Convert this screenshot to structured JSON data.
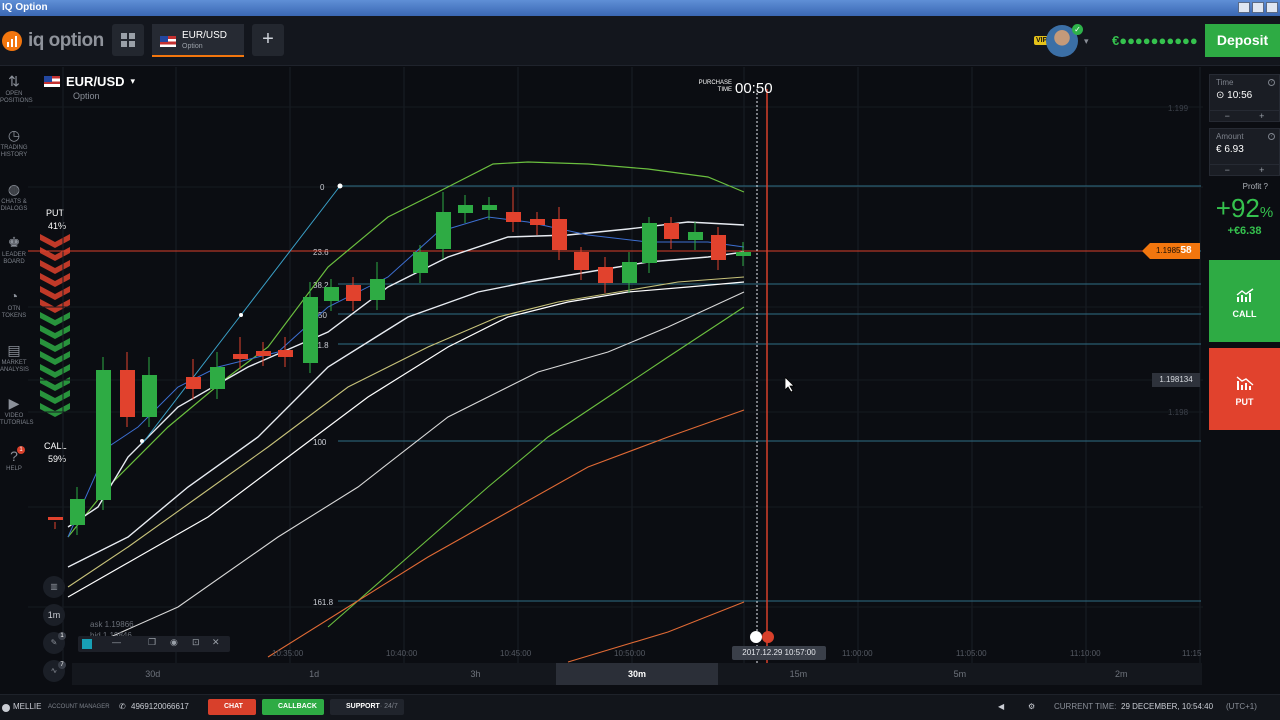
{
  "window": {
    "title": "IQ Option"
  },
  "header": {
    "logo_text": "iq option",
    "asset_tab": {
      "name": "EUR/USD",
      "type": "Option"
    },
    "add_label": "+",
    "vip_label": "VIP",
    "balance": "€●●●●●●●●●●",
    "deposit_label": "Deposit"
  },
  "leftnav": [
    {
      "icon": "arrows-updown-icon",
      "label": "OPEN POSITIONS"
    },
    {
      "icon": "history-icon",
      "label": "TRADING HISTORY"
    },
    {
      "icon": "chat-icon",
      "label": "CHATS & DIALOGS"
    },
    {
      "icon": "leaderboard-icon",
      "label": "LEADER BOARD"
    },
    {
      "icon": "token-icon",
      "label": "OTN TOKENS"
    },
    {
      "icon": "analysis-icon",
      "label": "MARKET ANALYSIS"
    },
    {
      "icon": "play-icon",
      "label": "VIDEO TUTORIALS"
    },
    {
      "icon": "help-icon",
      "label": "HELP",
      "badge": "1"
    }
  ],
  "chart": {
    "asset_name": "EUR/USD",
    "asset_type": "Option",
    "purchase_label": "PURCHASE TIME",
    "purchase_timer": "00:50",
    "sentiment": {
      "put_label": "PUT",
      "put_pct": "41%",
      "call_label": "CALL",
      "call_pct": "59%"
    },
    "current_price_prefix": "1.1985",
    "current_price_suffix": "58",
    "marker_price": "1.198134",
    "y_ticks": [
      "1.199",
      "1.198"
    ],
    "time_tooltip": "2017.12.29 10:57:00",
    "x_ticks": [
      "10:35:00",
      "10:40:00",
      "10:45:00",
      "10:50:00",
      "11:00:00",
      "11:05:00",
      "11:10:00",
      "11:15"
    ],
    "ask": "ask 1.19866",
    "bid": "bid 1.19846",
    "fib_levels": [
      "0",
      "23.6",
      "38.2",
      "50",
      "61.8",
      "100",
      "161.8"
    ]
  },
  "chart_data": {
    "type": "candlestick",
    "fib_levels": [
      "0",
      "23.6",
      "38.2",
      "50",
      "61.8",
      "100",
      "161.8"
    ],
    "current_price": "1.198558",
    "marker_price": "1.198134",
    "y_ticks": [
      "1.199",
      "1.198"
    ],
    "x_ticks": [
      "10:35:00",
      "10:40:00",
      "10:45:00",
      "10:50:00",
      "11:00:00",
      "11:05:00",
      "11:10:00",
      "11:15"
    ],
    "candles": [
      {
        "d": "down",
        "o": 0.0,
        "c": 0.0
      },
      {
        "d": "up"
      },
      {
        "d": "up"
      },
      {
        "d": "down"
      },
      {
        "d": "up"
      },
      {
        "d": "down"
      },
      {
        "d": "down"
      },
      {
        "d": "up"
      },
      {
        "d": "up"
      },
      {
        "d": "up"
      },
      {
        "d": "down"
      },
      {
        "d": "up"
      },
      {
        "d": "up"
      },
      {
        "d": "down"
      },
      {
        "d": "up"
      },
      {
        "d": "up"
      },
      {
        "d": "up"
      },
      {
        "d": "up"
      },
      {
        "d": "up"
      },
      {
        "d": "up"
      },
      {
        "d": "down"
      },
      {
        "d": "down"
      },
      {
        "d": "down"
      },
      {
        "d": "down"
      },
      {
        "d": "down"
      },
      {
        "d": "down"
      },
      {
        "d": "up"
      },
      {
        "d": "up"
      },
      {
        "d": "down"
      },
      {
        "d": "up"
      },
      {
        "d": "down"
      },
      {
        "d": "up"
      }
    ]
  },
  "tools": {
    "timeframe": "1m",
    "badge_a": "1",
    "badge_b": "7"
  },
  "periods": [
    "30d",
    "1d",
    "3h",
    "30m",
    "15m",
    "5m",
    "2m"
  ],
  "active_period": "30m",
  "rpanel": {
    "time_label": "Time",
    "time_value": "10:56",
    "amount_label": "Amount",
    "amount_value": "€  6.93",
    "minus": "−",
    "plus": "+",
    "profit_label": "Profit",
    "profit_pct": "+92",
    "profit_pct_sign": "%",
    "profit_amount": "+€6.38",
    "call_label": "CALL",
    "put_label": "PUT"
  },
  "statusbar": {
    "user": "MELLIE",
    "account_manager": "ACCOUNT MANAGER",
    "phone": "4969120066617",
    "chat": "CHAT",
    "callback": "CALLBACK",
    "support": "SUPPORT",
    "support_sub": "· 24/7",
    "current_time_label": "CURRENT TIME:",
    "current_time": "29 DECEMBER, 10:54:40",
    "tz": "(UTC+1)"
  },
  "colors": {
    "accent": "#f2760e",
    "green": "#2eab44",
    "red": "#e1422d"
  }
}
